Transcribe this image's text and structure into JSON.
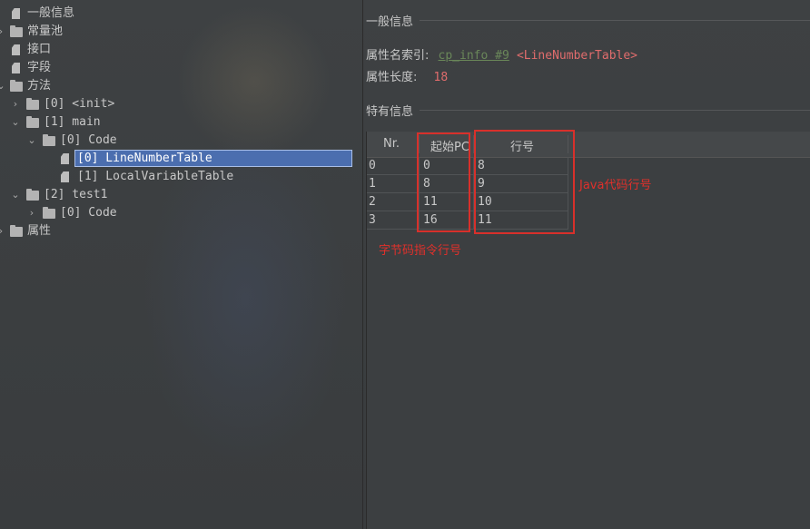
{
  "tree": {
    "items": [
      {
        "label": "一般信息",
        "icon": "file-icon"
      },
      {
        "label": "常量池",
        "icon": "folder-icon",
        "arrow": "›"
      },
      {
        "label": "接口",
        "icon": "file-icon"
      },
      {
        "label": "字段",
        "icon": "file-icon"
      },
      {
        "label": "方法",
        "icon": "folder-icon",
        "arrow": "⌄"
      },
      {
        "label": "[0] <init>",
        "icon": "folder-icon",
        "arrow": "›"
      },
      {
        "label": "[1] main",
        "icon": "folder-icon",
        "arrow": "⌄"
      },
      {
        "label": "[0] Code",
        "icon": "folder-icon",
        "arrow": "⌄"
      },
      {
        "label": "[0] LineNumberTable",
        "icon": "file-icon",
        "selected": true
      },
      {
        "label": "[1] LocalVariableTable",
        "icon": "file-icon"
      },
      {
        "label": "[2] test1",
        "icon": "folder-icon",
        "arrow": "⌄"
      },
      {
        "label": "[0] Code",
        "icon": "folder-icon",
        "arrow": "›"
      },
      {
        "label": "属性",
        "icon": "folder-icon",
        "arrow": "›"
      }
    ]
  },
  "general": {
    "title": "一般信息",
    "name_index_label": "属性名索引:",
    "name_index_link": "cp_info #9",
    "name_index_value": "<LineNumberTable>",
    "length_label": "属性长度:",
    "length_value": "18"
  },
  "specific": {
    "title": "特有信息",
    "columns": [
      "Nr.",
      "起始PC",
      "行号"
    ],
    "rows": [
      [
        "0",
        "0",
        "8"
      ],
      [
        "1",
        "8",
        "9"
      ],
      [
        "2",
        "11",
        "10"
      ],
      [
        "3",
        "16",
        "11"
      ]
    ]
  },
  "annotations": {
    "java_line": "Java代码行号",
    "bytecode_line": "字节码指令行号"
  },
  "colors": {
    "selection": "#4b6eaf",
    "annotation_red": "#d8302b",
    "link_green": "#6a8759"
  }
}
